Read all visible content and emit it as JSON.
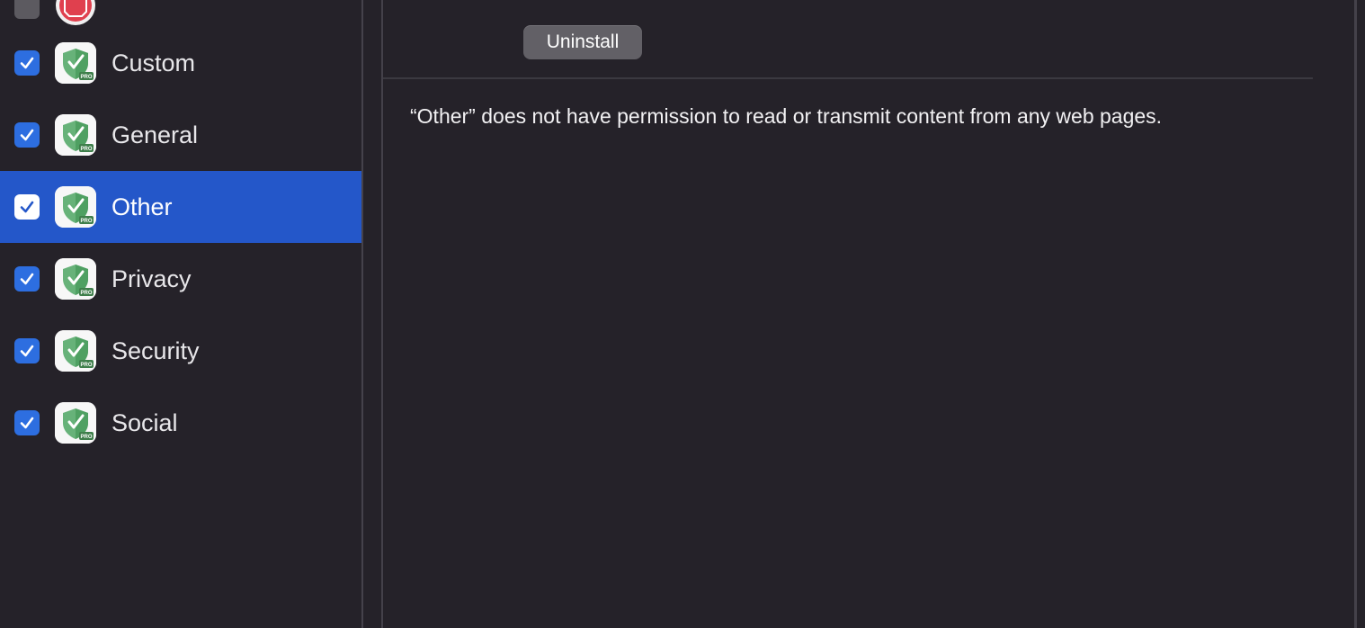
{
  "sidebar": {
    "items": [
      {
        "label": "",
        "checked": false,
        "icon": "stop-sign-icon"
      },
      {
        "label": "Custom",
        "checked": true,
        "icon": "adguard-pro-icon"
      },
      {
        "label": "General",
        "checked": true,
        "icon": "adguard-pro-icon"
      },
      {
        "label": "Other",
        "checked": true,
        "icon": "adguard-pro-icon",
        "selected": true
      },
      {
        "label": "Privacy",
        "checked": true,
        "icon": "adguard-pro-icon"
      },
      {
        "label": "Security",
        "checked": true,
        "icon": "adguard-pro-icon"
      },
      {
        "label": "Social",
        "checked": true,
        "icon": "adguard-pro-icon"
      }
    ]
  },
  "main": {
    "uninstall_label": "Uninstall",
    "permission_text": "“Other” does not have permission to read or transmit content from any web pages."
  },
  "colors": {
    "background": "#252229",
    "selection": "#2457c9",
    "checkbox": "#2d6ee0",
    "shield_green": "#5cb85c"
  }
}
